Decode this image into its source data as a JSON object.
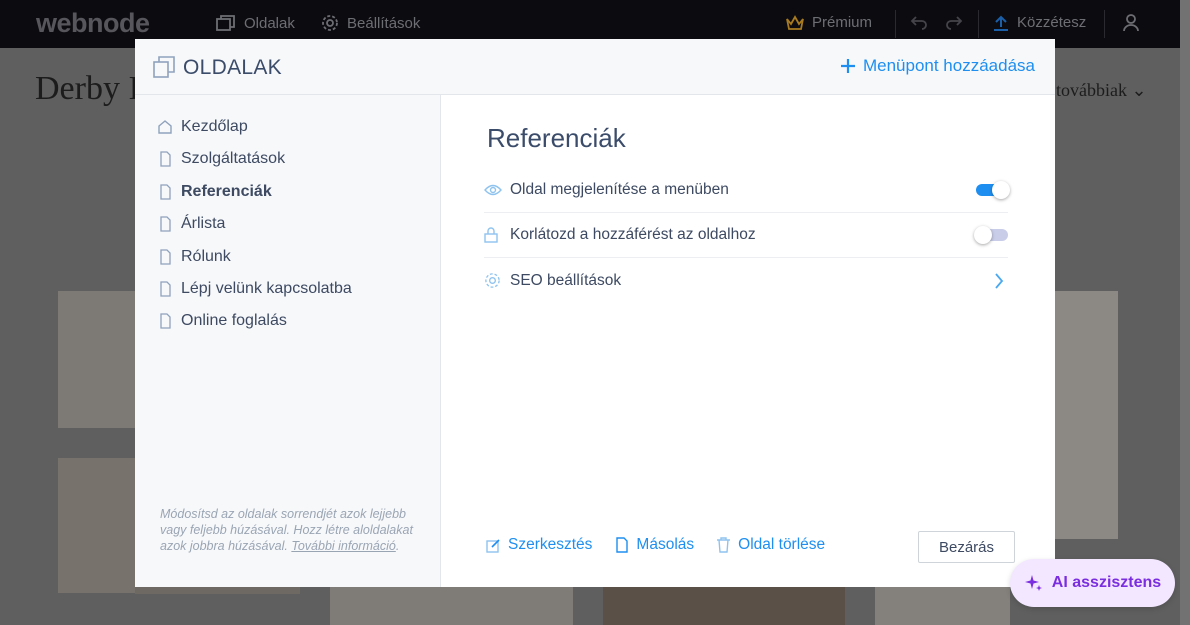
{
  "topbar": {
    "logo": "webnode",
    "pages_label": "Oldalak",
    "settings_label": "Beállítások",
    "premium_label": "Prémium",
    "publish_label": "Közzétesz"
  },
  "background": {
    "site_title": "Derby I",
    "menu_more": "továbbiak"
  },
  "modal": {
    "title": "OLDALAK",
    "add_label": "Menüpont hozzáadása",
    "pages": [
      {
        "label": "Kezdőlap",
        "icon": "home-icon",
        "active": false
      },
      {
        "label": "Szolgáltatások",
        "icon": "page-icon",
        "active": false
      },
      {
        "label": "Referenciák",
        "icon": "page-icon",
        "active": true
      },
      {
        "label": "Árlista",
        "icon": "page-icon",
        "active": false
      },
      {
        "label": "Rólunk",
        "icon": "page-icon",
        "active": false
      },
      {
        "label": "Lépj velünk kapcsolatba",
        "icon": "page-icon",
        "active": false
      },
      {
        "label": "Online foglalás",
        "icon": "page-icon",
        "active": false
      }
    ],
    "hint_text": "Módosítsd az oldalak sorrendjét azok lejjebb vagy feljebb húzásával. Hozz létre aloldalakat azok jobbra húzásával.",
    "hint_link": "További információ",
    "hint_end": ".",
    "selected_page": "Referenciák",
    "options": {
      "show_in_menu": {
        "label": "Oldal megjelenítése a menüben",
        "enabled": true
      },
      "restrict_access": {
        "label": "Korlátozd a hozzáférést az oldalhoz",
        "enabled": false
      },
      "seo": {
        "label": "SEO beállítások"
      }
    },
    "actions": {
      "edit": "Szerkesztés",
      "copy": "Másolás",
      "delete": "Oldal törlése",
      "close": "Bezárás"
    }
  },
  "ai_assistant": "AI asszisztens",
  "colors": {
    "accent": "#1e8ff0",
    "text": "#3d4a62",
    "ai": "#7b2ee0"
  }
}
